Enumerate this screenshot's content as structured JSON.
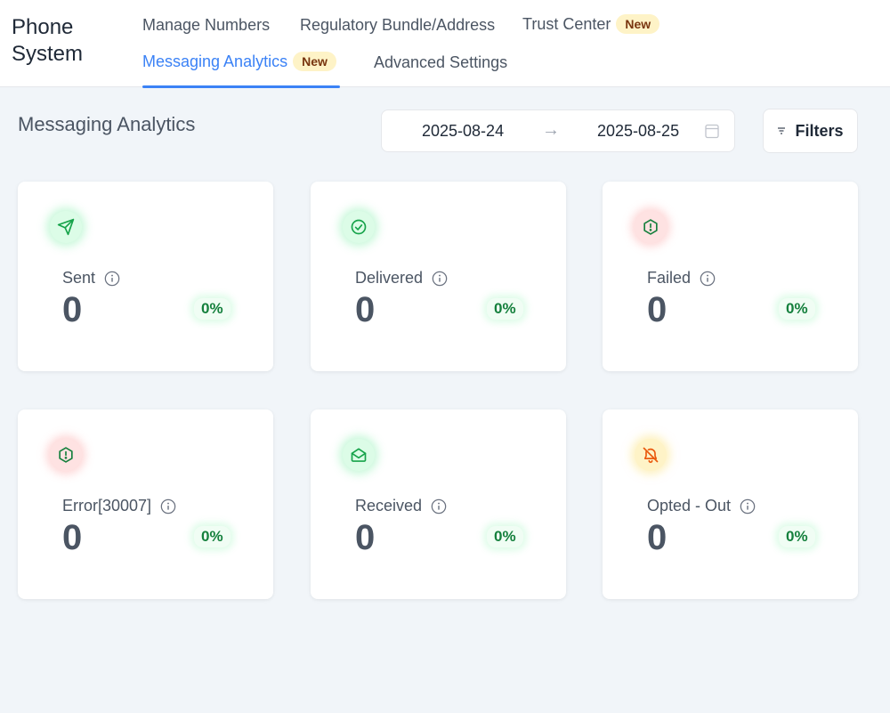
{
  "app": {
    "title_line1": "Phone",
    "title_line2": "System"
  },
  "tabs": [
    {
      "label": "Manage Numbers"
    },
    {
      "label": "Regulatory Bundle/Address"
    },
    {
      "label": "Trust Center",
      "badge": "New"
    },
    {
      "label": "Messaging Analytics",
      "badge": "New",
      "active": true
    },
    {
      "label": "Advanced Settings"
    }
  ],
  "page": {
    "title": "Messaging Analytics"
  },
  "date_range": {
    "start": "2025-08-24",
    "end": "2025-08-25",
    "arrow": "→"
  },
  "filters": {
    "label": "Filters"
  },
  "cards": [
    {
      "label": "Sent",
      "value": "0",
      "percent": "0%",
      "icon": "send-icon",
      "tone": "green"
    },
    {
      "label": "Delivered",
      "value": "0",
      "percent": "0%",
      "icon": "check-circle-icon",
      "tone": "green"
    },
    {
      "label": "Failed",
      "value": "0",
      "percent": "0%",
      "icon": "alert-hexagon-icon",
      "tone": "red"
    },
    {
      "label": "Error[30007]",
      "value": "0",
      "percent": "0%",
      "icon": "alert-hexagon-icon",
      "tone": "red"
    },
    {
      "label": "Received",
      "value": "0",
      "percent": "0%",
      "icon": "envelope-open-icon",
      "tone": "green"
    },
    {
      "label": "Opted - Out",
      "value": "0",
      "percent": "0%",
      "icon": "bell-off-icon",
      "tone": "amber"
    }
  ],
  "colors": {
    "accent": "#3b82f6",
    "badge_bg": "#fef3c7",
    "success": "#15803d",
    "danger": "#dc2626",
    "warning": "#ea580c"
  }
}
